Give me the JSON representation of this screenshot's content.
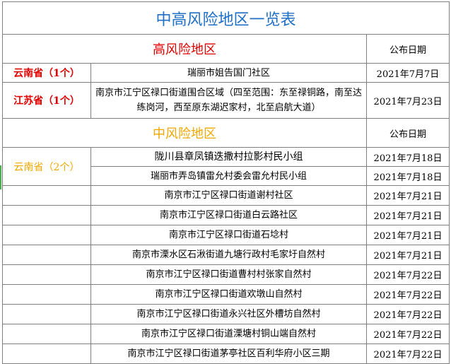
{
  "title": "中高风险地区一览表",
  "high": {
    "label": "高风险地区",
    "date_header": "公布日期",
    "groups": [
      {
        "province": "云南省（1个）",
        "location": "瑞丽市姐告国门社区",
        "date": "2021年7月7日"
      },
      {
        "province": "江苏省（1个）",
        "location": "南京市江宁区禄口街道围合区域（四至范围：东至禄铜路，南至达练岗河，西至原东湖迟家村，北至启航大道）",
        "date": "2021年7月23日"
      }
    ]
  },
  "mid": {
    "label": "中风险地区",
    "date_header": "公布日期",
    "yunnan": {
      "province": "云南省（2个）",
      "rows": [
        {
          "location": "陇川县章凤镇迭撒村拉影村民小组",
          "date": "2021年7月18日"
        },
        {
          "location": "瑞丽市弄岛镇雷允村委会雷允村民小组",
          "date": "2021年7月18日"
        }
      ]
    },
    "other_rows": [
      {
        "location": "南京市江宁区禄口街道谢村社区",
        "date": "2021年7月21日"
      },
      {
        "location": "南京市江宁区禄口街道白云路社区",
        "date": "2021年7月21日"
      },
      {
        "location": "南京市江宁区禄口街道石埝村",
        "date": "2021年7月21日"
      },
      {
        "location": "南京市溧水区石湫街道九塘行政村毛家圩自然村",
        "date": "2021年7月21日"
      },
      {
        "location": "南京市江宁区禄口街道曹村村张家自然村",
        "date": "2021年7月22日"
      },
      {
        "location": "南京市江宁区禄口街道欢墩山自然村",
        "date": "2021年7月22日"
      },
      {
        "location": "南京市江宁区禄口街道永兴社区外槽坊自然村",
        "date": "2021年7月22日"
      },
      {
        "location": "南京市江宁区禄口街道溧塘村铜山端自然村",
        "date": "2021年7月22日"
      },
      {
        "location": "南京市江宁区禄口街道茅亭社区百利华府小区三期",
        "date": "2021年7月22日"
      }
    ]
  }
}
